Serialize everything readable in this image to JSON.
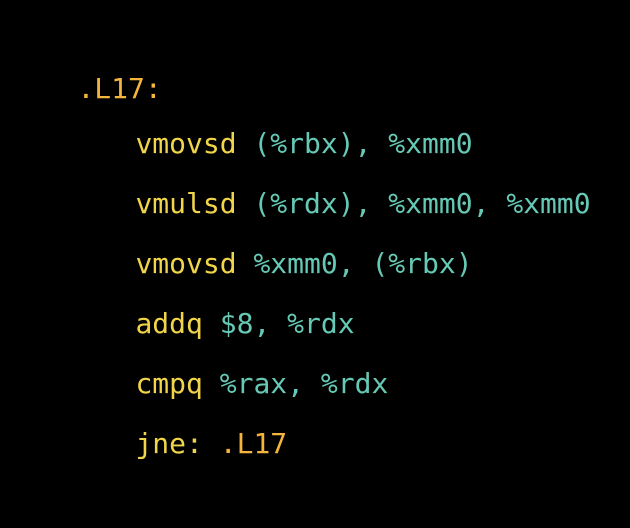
{
  "colors": {
    "background": "#000000",
    "label": "#f5b53d",
    "mnemonic": "#f0d54a",
    "operand": "#66c9b6"
  },
  "code": {
    "label": ".L17:",
    "lines": [
      {
        "mnemonic": "vmovsd",
        "operands": " (%rbx), %xmm0"
      },
      {
        "mnemonic": "vmulsd",
        "operands": " (%rdx), %xmm0, %xmm0"
      },
      {
        "mnemonic": "vmovsd",
        "operands": " %xmm0, (%rbx)"
      },
      {
        "mnemonic": "addq",
        "operands": " $8, %rdx"
      },
      {
        "mnemonic": "cmpq",
        "operands": " %rax, %rdx"
      },
      {
        "mnemonic": "jne:",
        "operands": " .L17"
      }
    ]
  }
}
